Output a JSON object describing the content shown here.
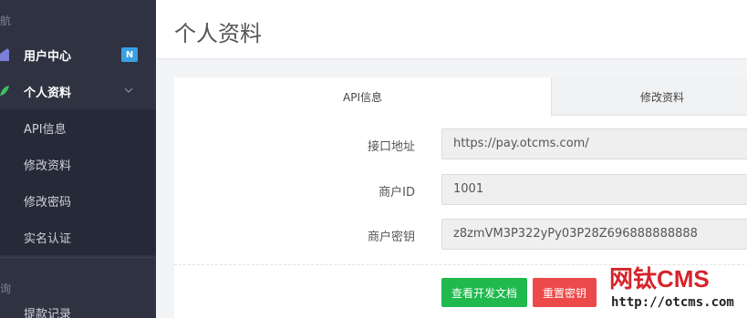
{
  "sidebar": {
    "section1_label": "航",
    "items": [
      {
        "label": "用户中心",
        "badge": "N",
        "icon": "home-icon"
      },
      {
        "label": "个人资料",
        "icon": "leaf-icon"
      },
      {
        "label": "API信息"
      },
      {
        "label": "修改资料"
      },
      {
        "label": "修改密码"
      },
      {
        "label": "实名认证"
      }
    ],
    "section2_label": "询",
    "next_item_partial": "提款记录"
  },
  "page": {
    "title": "个人资料"
  },
  "tabs": [
    {
      "label": "API信息",
      "active": true
    },
    {
      "label": "修改资料",
      "active": false
    }
  ],
  "form": {
    "fields": [
      {
        "label": "接口地址",
        "value": "https://pay.otcms.com/"
      },
      {
        "label": "商户ID",
        "value": "1001"
      },
      {
        "label": "商户密钥",
        "value": "z8zmVM3P322yPy03P28Z696888888888"
      }
    ],
    "buttons": {
      "docs": "查看开发文档",
      "reset": "重置密钥"
    }
  },
  "watermark": {
    "logo": "网钛CMS",
    "url": "http://otcms.com"
  },
  "colors": {
    "sidebar_bg": "#2f3241",
    "accent_blue": "#3aa0e0",
    "button_green": "#1fb94e",
    "button_red": "#ec4a4a",
    "brand_red": "#d6232a"
  }
}
